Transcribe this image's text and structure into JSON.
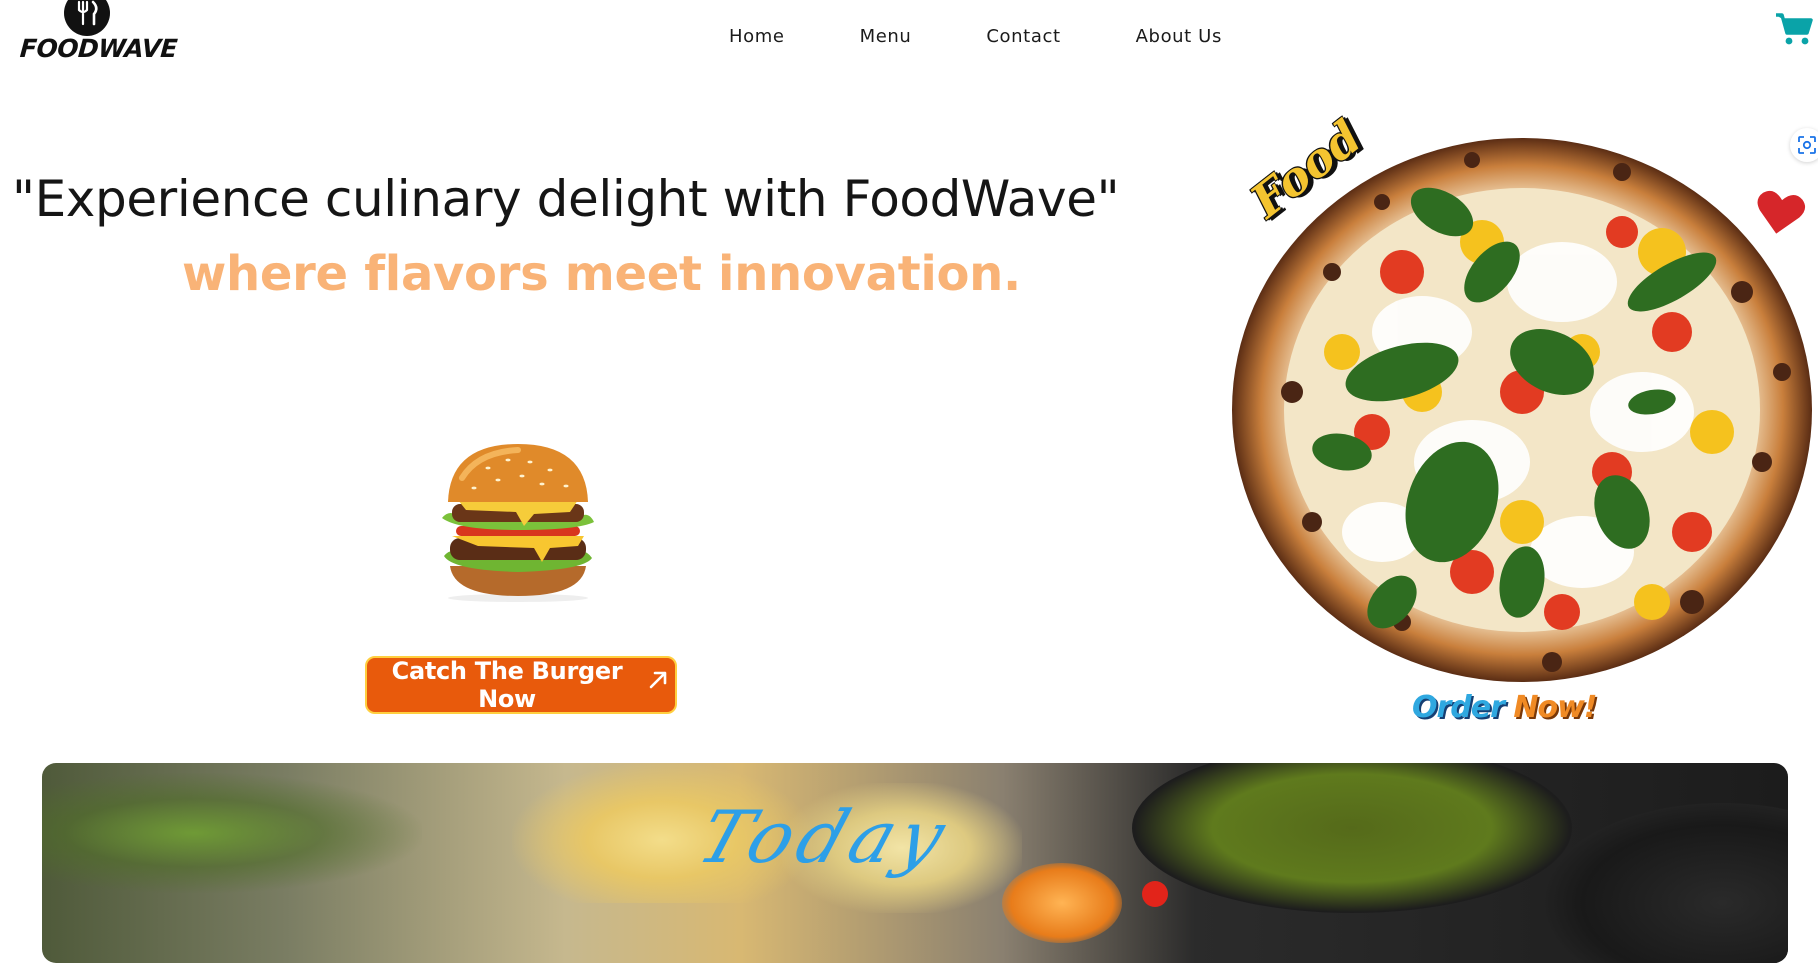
{
  "brand": {
    "name": "FOODWAVE",
    "logo_icon": "fork-knife-icon"
  },
  "nav": {
    "items": [
      {
        "label": "Home"
      },
      {
        "label": "Menu"
      },
      {
        "label": "Contact"
      },
      {
        "label": "About Us"
      }
    ]
  },
  "header": {
    "cart_icon": "cart-icon",
    "cart_color": "#0aa3a8",
    "side_icon": "scan-icon"
  },
  "hero": {
    "headline": "\"Experience culinary delight with FoodWave\"",
    "subline": "where flavors meet innovation.",
    "subline_color": "#f9b377",
    "cta_label": "Catch The Burger Now",
    "cta_icon": "arrow-up-right-icon",
    "cta_color": "#e85a0c",
    "burger_image": "burger-image"
  },
  "promo": {
    "sticker": "Food",
    "order_part1": "Order",
    "order_part2": "Now!",
    "pizza_image": "pizza-image",
    "heart_icon": "heart-icon"
  },
  "banner": {
    "script_text": "Today"
  }
}
